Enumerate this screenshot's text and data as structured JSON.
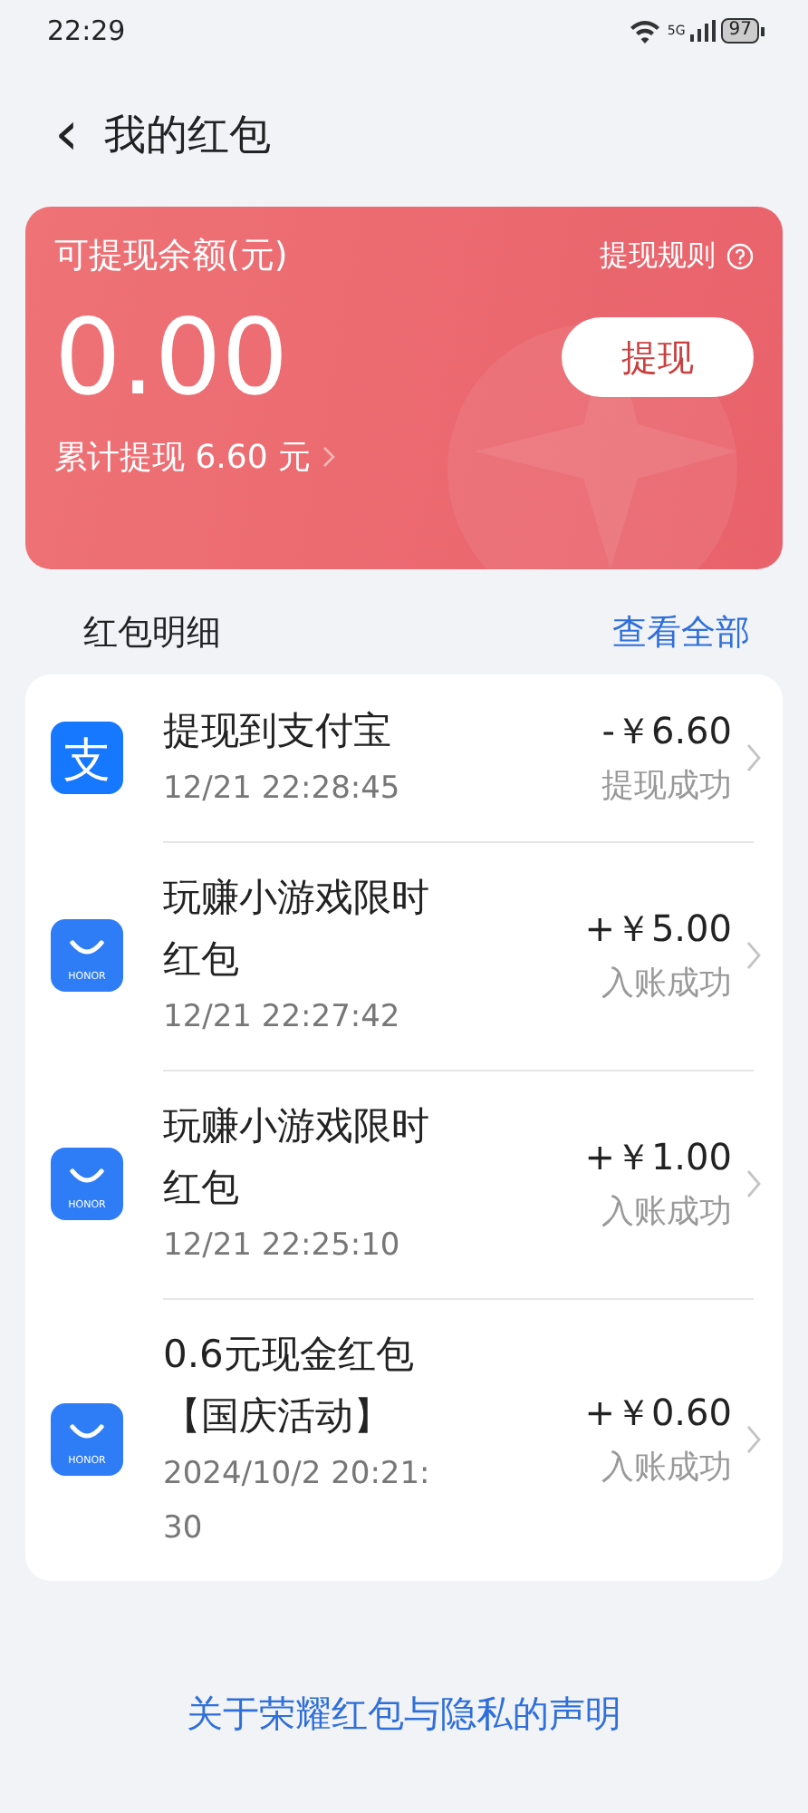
{
  "status_bar": {
    "time": "22:29",
    "network": "5G",
    "battery": "97"
  },
  "header": {
    "back": "‹",
    "title": "我的红包"
  },
  "balance_card": {
    "label": "可提现余额(元)",
    "rules": "提现规则",
    "amount": "0.00",
    "withdraw_button": "提现",
    "total": "累计提现 6.60 元"
  },
  "details": {
    "title": "红包明细",
    "view_all": "查看全部",
    "rows": [
      {
        "kind": "alipay",
        "icon_text": "支",
        "title": "提现到支付宝",
        "time": "12/21 22:28:45",
        "amount": "-￥6.60",
        "status": "提现成功"
      },
      {
        "kind": "honor",
        "icon_text": "HONOR",
        "title": "玩赚小游戏限时红包",
        "time": "12/21 22:27:42",
        "amount": "+￥5.00",
        "status": "入账成功"
      },
      {
        "kind": "honor",
        "icon_text": "HONOR",
        "title": "玩赚小游戏限时红包",
        "time": "12/21 22:25:10",
        "amount": "+￥1.00",
        "status": "入账成功"
      },
      {
        "kind": "honor",
        "icon_text": "HONOR",
        "title": "0.6元现金红包【国庆活动】",
        "time": "2024/10/2 20:21:30",
        "amount": "+￥0.60",
        "status": "入账成功"
      }
    ]
  },
  "footer": {
    "link": "关于荣耀红包与隐私的声明"
  }
}
